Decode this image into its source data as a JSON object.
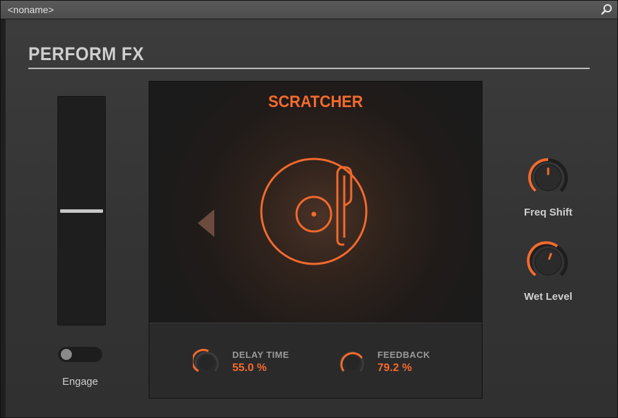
{
  "window": {
    "preset_name": "<noname>"
  },
  "panel": {
    "title": "PERFORM FX"
  },
  "fader": {
    "level": 0.5
  },
  "engage": {
    "label": "Engage",
    "on": false
  },
  "effect": {
    "name": "SCRATCHER",
    "icon": "turntable-icon"
  },
  "params": [
    {
      "label": "DELAY TIME",
      "value": "55.0 %"
    },
    {
      "label": "FEEDBACK",
      "value": "79.2 %"
    }
  ],
  "knobs": [
    {
      "label": "Freq Shift"
    },
    {
      "label": "Wet Level"
    }
  ],
  "colors": {
    "accent": "#f26a2e",
    "background": "#2d2d2d",
    "display_bg": "#1b1b1b"
  }
}
